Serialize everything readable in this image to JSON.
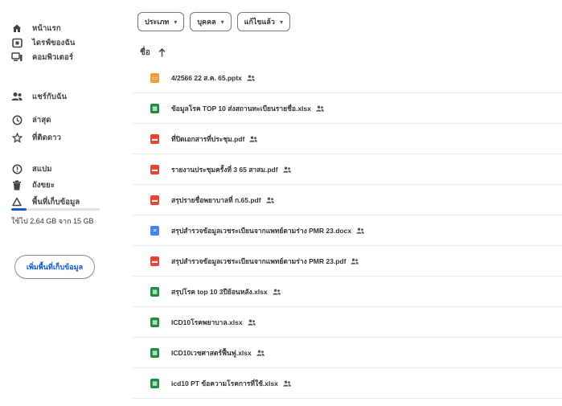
{
  "sidebar": {
    "items": [
      {
        "label": "หน้าแรก",
        "icon": "home-icon"
      },
      {
        "label": "ไดรฟ์ของฉัน",
        "icon": "my-drive-icon"
      },
      {
        "label": "คอมพิวเตอร์",
        "icon": "computer-icon"
      },
      {
        "label": "แชร์กับฉัน",
        "icon": "shared-with-me-icon"
      },
      {
        "label": "ล่าสุด",
        "icon": "recent-icon"
      },
      {
        "label": "ที่ติดดาว",
        "icon": "star-icon"
      },
      {
        "label": "สแปม",
        "icon": "spam-icon"
      },
      {
        "label": "ถังขยะ",
        "icon": "trash-icon"
      },
      {
        "label": "พื้นที่เก็บข้อมูล",
        "icon": "cloud-icon"
      }
    ],
    "storage": {
      "text": "ใช้ไป 2.64 GB จาก 15 GB",
      "used_fraction": 0.176
    },
    "buy_storage_label": "เพิ่มพื้นที่เก็บข้อมูล"
  },
  "filters": [
    {
      "label": "ประเภท"
    },
    {
      "label": "บุคคล"
    },
    {
      "label": "แก้ไขแล้ว"
    }
  ],
  "sort": {
    "label": "ชื่อ",
    "icon": "arrow-up-icon"
  },
  "colors": {
    "slides": "#f29c38",
    "sheets": "#1e8e3e",
    "pdf": "#ea4335",
    "docs": "#4285f4",
    "accent": "#0b57d0"
  },
  "files": [
    {
      "name": "4/2566 22 ส.ค. 65.pptx",
      "type": "slides",
      "shared": true
    },
    {
      "name": "ข้อมูลโรค TOP 10 ส่งสถานทะเบียนรายชื่อ.xlsx",
      "type": "sheets",
      "shared": true
    },
    {
      "name": "ที่ปิดเอกสารที่ประชุม.pdf",
      "type": "pdf",
      "shared": true
    },
    {
      "name": "รายงานประชุมครั้งที่ 3 65 สาสม.pdf",
      "type": "pdf",
      "shared": true
    },
    {
      "name": "สรุปรายชื่อพยาบาลที่ ก.65.pdf",
      "type": "pdf",
      "shared": true
    },
    {
      "name": "สรุปสำรวจข้อมูลเวชระเบียนจากแพทย์ตามร่าง PMR 23.docx",
      "type": "docs",
      "shared": true
    },
    {
      "name": "สรุปสำรวจข้อมูลเวชระเบียนจากแพทย์ตามร่าง PMR 23.pdf",
      "type": "pdf",
      "shared": true
    },
    {
      "name": "สรุปโรค top 10 3ปีย้อนหลัง.xlsx",
      "type": "sheets",
      "shared": true
    },
    {
      "name": "ICD10โรคพยาบาล.xlsx",
      "type": "sheets",
      "shared": true
    },
    {
      "name": "ICD10เวชศาสตร์ฟื้นฟู.xlsx",
      "type": "sheets",
      "shared": true
    },
    {
      "name": "icd10 PT ข้อความโรคการที่ใช้.xlsx",
      "type": "sheets",
      "shared": true
    }
  ]
}
